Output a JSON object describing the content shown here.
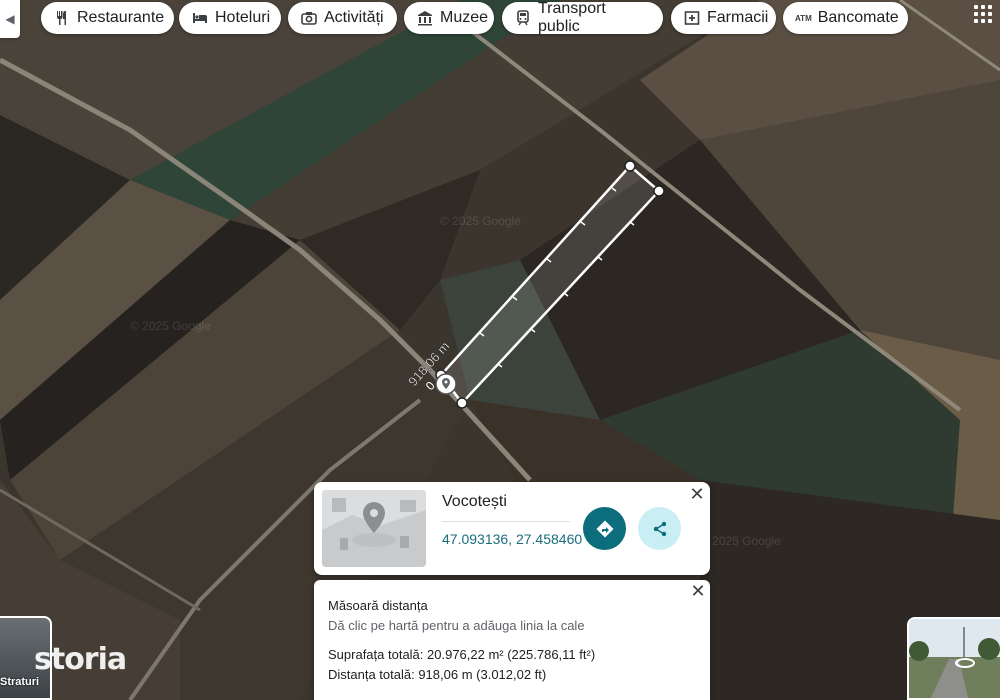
{
  "chips": [
    {
      "label": "Restaurante",
      "icon": "fork-knife-icon"
    },
    {
      "label": "Hoteluri",
      "icon": "bed-icon"
    },
    {
      "label": "Activități",
      "icon": "camera-icon"
    },
    {
      "label": "Muzee",
      "icon": "museum-icon"
    },
    {
      "label": "Transport public",
      "icon": "train-icon"
    },
    {
      "label": "Farmacii",
      "icon": "pharmacy-icon"
    },
    {
      "label": "Bancomate",
      "icon": "atm-icon",
      "icon_text": "ATM"
    }
  ],
  "map": {
    "measure_label": "918,06 m",
    "measure_start": "0",
    "watermark": "© 2025 Google"
  },
  "place_card": {
    "name": "Vocotești",
    "coordinates": "47.093136, 27.458460",
    "close_symbol": "✕"
  },
  "measure_panel": {
    "title": "Măsoară distanța",
    "hint": "Dă clic pe hartă pentru a adăuga linia la cale",
    "total_area": "Suprafața totală: 20.976,22 m² (225.786,11 ft²)",
    "total_distance": "Distanța totală: 918,06 m (3.012,02 ft)",
    "close_symbol": "✕"
  },
  "layers": {
    "label": "Straturi"
  },
  "brand": {
    "text": "storia"
  },
  "colors": {
    "accent": "#0c6e7c",
    "link": "#1a6e7c",
    "share_bg": "#c9eef4"
  }
}
